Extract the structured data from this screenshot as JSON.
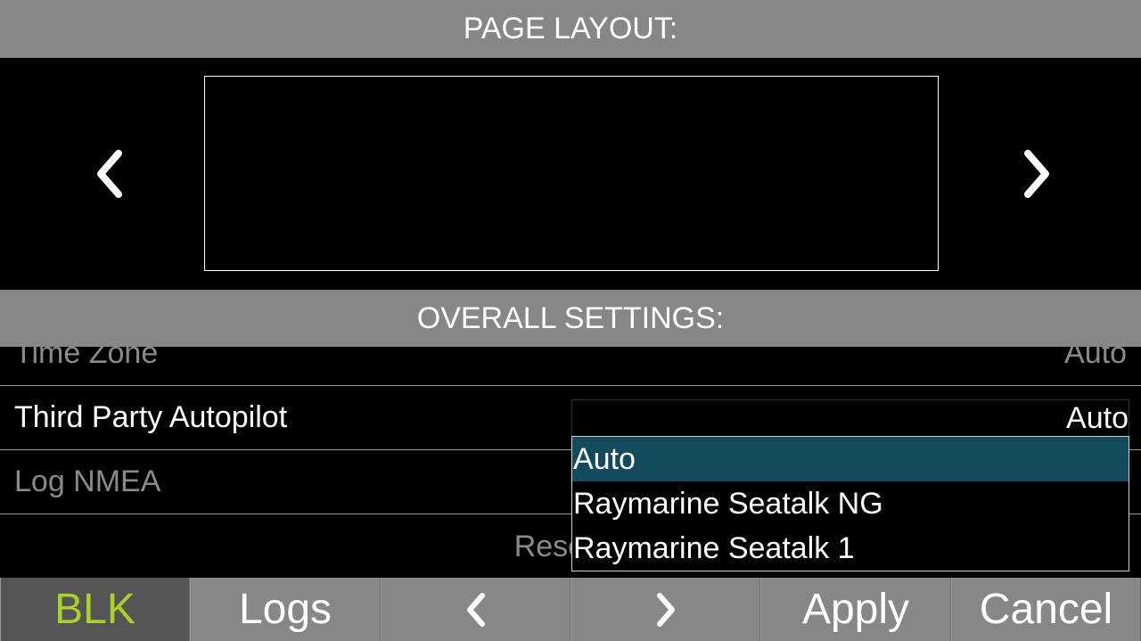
{
  "page_layout": {
    "title": "PAGE LAYOUT:"
  },
  "overall_settings": {
    "title": "OVERALL SETTINGS:",
    "rows": [
      {
        "label": "Time Zone",
        "value": "Auto"
      },
      {
        "label": "Third Party Autopilot",
        "value": "Auto"
      },
      {
        "label": "Log NMEA",
        "value": ""
      },
      {
        "label": "Reset to",
        "value": ""
      }
    ]
  },
  "autopilot_dropdown": {
    "selected": "Auto",
    "options": [
      "Auto",
      "Raymarine Seatalk NG",
      "Raymarine Seatalk 1"
    ]
  },
  "toolbar": {
    "blk": "BLK",
    "logs": "Logs",
    "apply": "Apply",
    "cancel": "Cancel"
  },
  "colors": {
    "header_gray": "#878787",
    "selected_option": "#134a5c",
    "active_button_text": "#a8d22a"
  },
  "icons": {
    "prev": "chevron-left-icon",
    "next": "chevron-right-icon"
  }
}
